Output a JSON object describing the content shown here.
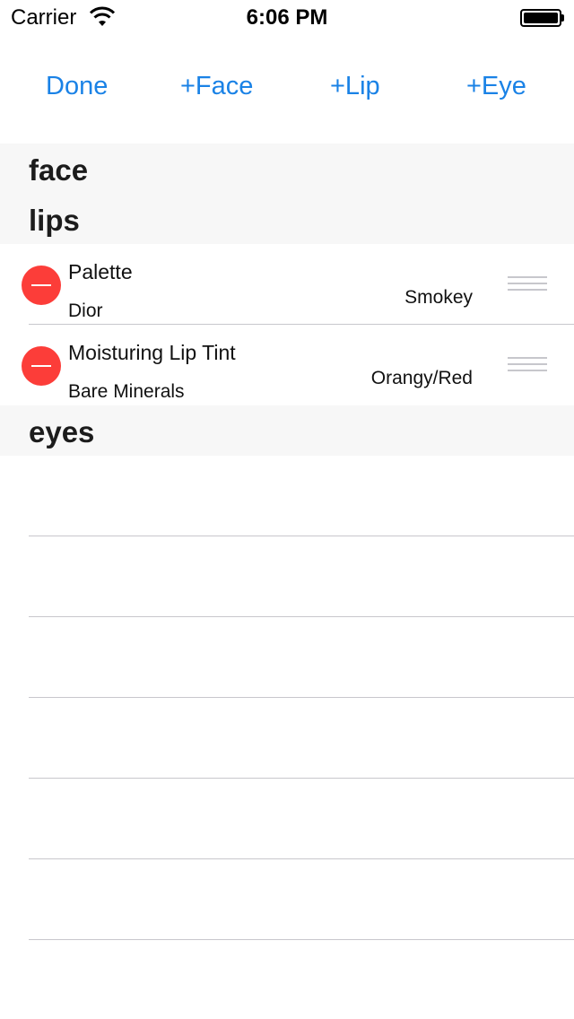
{
  "status_bar": {
    "carrier": "Carrier",
    "time": "6:06 PM",
    "wifi_icon": "wifi-icon",
    "battery_icon": "battery-icon"
  },
  "toolbar": {
    "done_label": "Done",
    "add_face_label": "+Face",
    "add_lip_label": "+Lip",
    "add_eye_label": "+Eye",
    "accent_color": "#1a82e6"
  },
  "sections": [
    {
      "title": "face",
      "items": []
    },
    {
      "title": "lips",
      "items": [
        {
          "name": "Palette",
          "brand": "Dior",
          "shade": "Smokey"
        },
        {
          "name": "Moisturing Lip Tint",
          "brand": "Bare Minerals",
          "shade": "Orangy/Red"
        }
      ]
    },
    {
      "title": "eyes",
      "items": []
    }
  ],
  "colors": {
    "delete": "#fc3d39",
    "section_bg": "#f7f7f7",
    "separator": "#c8c7cc"
  }
}
